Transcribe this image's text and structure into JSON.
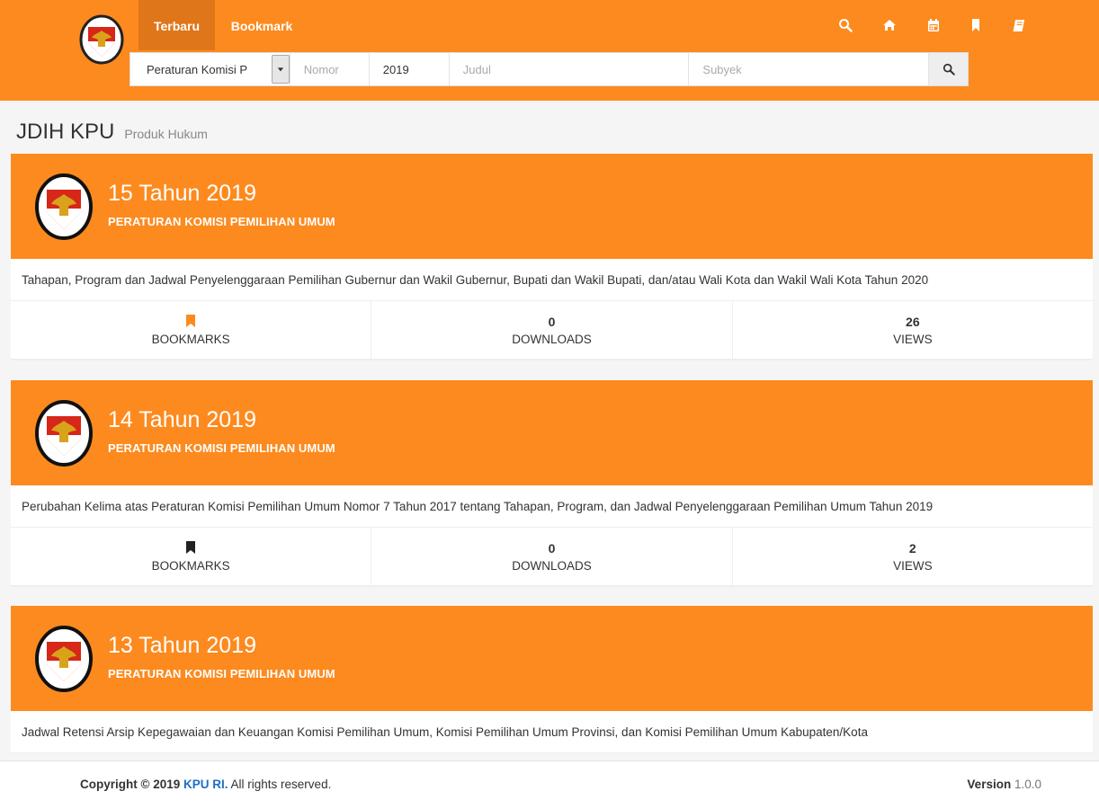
{
  "nav": {
    "tabs": [
      {
        "label": "Terbaru",
        "active": true
      },
      {
        "label": "Bookmark",
        "active": false
      }
    ],
    "icons": [
      "search-icon",
      "home-icon",
      "calendar-icon",
      "bookmark-icon",
      "book-icon"
    ]
  },
  "search": {
    "type_value": "Peraturan Komisi P",
    "nomor_placeholder": "Nomor",
    "tahun_value": "2019",
    "judul_placeholder": "Judul",
    "subyek_placeholder": "Subyek"
  },
  "page": {
    "title": "JDIH KPU",
    "subtitle": "Produk Hukum"
  },
  "cards": [
    {
      "title": "15 Tahun 2019",
      "category": "PERATURAN KOMISI PEMILIHAN UMUM",
      "description": "Tahapan, Program dan Jadwal Penyelenggaraan Pemilihan Gubernur dan Wakil Gubernur, Bupati dan Wakil Bupati, dan/atau Wali Kota dan Wakil Wali Kota Tahun 2020",
      "bookmarked": true,
      "bookmarks_label": "BOOKMARKS",
      "downloads": "0",
      "downloads_label": "DOWNLOADS",
      "views": "26",
      "views_label": "VIEWS"
    },
    {
      "title": "14 Tahun 2019",
      "category": "PERATURAN KOMISI PEMILIHAN UMUM",
      "description": "Perubahan Kelima atas Peraturan Komisi Pemilihan Umum Nomor 7 Tahun 2017 tentang Tahapan, Program, dan Jadwal Penyelenggaraan Pemilihan Umum Tahun 2019",
      "bookmarked": false,
      "bookmarks_label": "BOOKMARKS",
      "downloads": "0",
      "downloads_label": "DOWNLOADS",
      "views": "2",
      "views_label": "VIEWS"
    },
    {
      "title": "13 Tahun 2019",
      "category": "PERATURAN KOMISI PEMILIHAN UMUM",
      "description": "Jadwal Retensi Arsip Kepegawaian dan Keuangan Komisi Pemilihan Umum, Komisi Pemilihan Umum Provinsi, dan Komisi Pemilihan Umum Kabupaten/Kota"
    }
  ],
  "footer": {
    "copyright_prefix": "Copyright © 2019",
    "org_link": "KPU RI.",
    "rights": "All rights reserved.",
    "version_label": "Version",
    "version_value": "1.0.0"
  },
  "colors": {
    "brand_orange": "#fd8a1e",
    "active_tab": "#e0761a",
    "bookmark_active": "#fd8a1e",
    "bookmark_inactive": "#222222"
  }
}
